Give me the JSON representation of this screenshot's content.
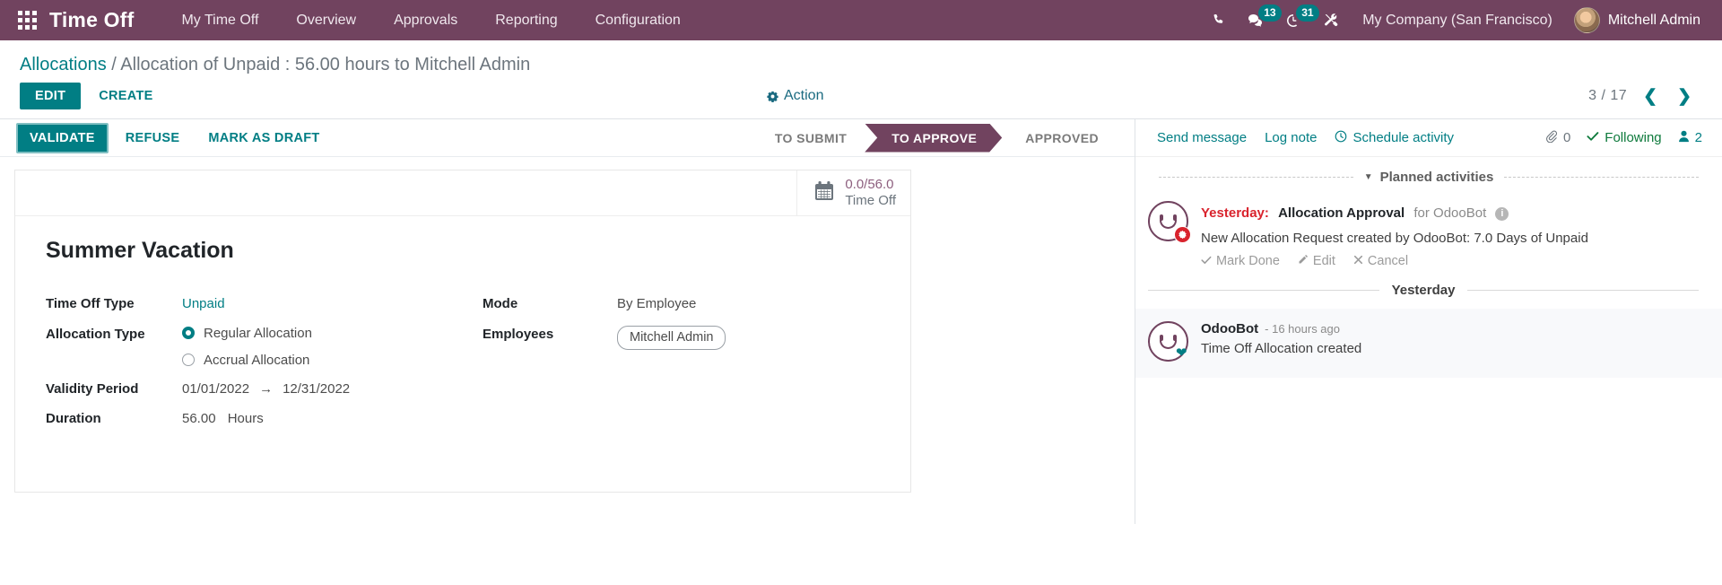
{
  "navbar": {
    "apps_icon": "apps-grid-icon",
    "brand": "Time Off",
    "menu": [
      {
        "label": "My Time Off"
      },
      {
        "label": "Overview"
      },
      {
        "label": "Approvals"
      },
      {
        "label": "Reporting"
      },
      {
        "label": "Configuration"
      }
    ],
    "icons": [
      {
        "name": "phone-icon",
        "badge": ""
      },
      {
        "name": "messages-icon",
        "badge": "13"
      },
      {
        "name": "activity-clock-icon",
        "badge": "31"
      },
      {
        "name": "tools-icon",
        "badge": ""
      }
    ],
    "company": "My Company (San Francisco)",
    "user": "Mitchell Admin",
    "bg_color": "#71435f",
    "badge_color": "#017e84"
  },
  "breadcrumb": {
    "root": "Allocations",
    "separator": "/",
    "current": "Allocation of Unpaid : 56.00 hours to Mitchell Admin"
  },
  "control_panel": {
    "edit_label": "EDIT",
    "create_label": "CREATE",
    "action_label": "Action",
    "action_icon": "gear-icon",
    "pager": {
      "count": "3 / 17",
      "prev_icon": "chevron-left-icon",
      "next_icon": "chevron-right-icon"
    }
  },
  "statusbar": {
    "buttons": [
      {
        "label": "VALIDATE",
        "primary": true
      },
      {
        "label": "REFUSE",
        "primary": false
      },
      {
        "label": "MARK AS DRAFT",
        "primary": false
      }
    ],
    "stages": [
      {
        "label": "TO SUBMIT",
        "active": false
      },
      {
        "label": "TO APPROVE",
        "active": true
      },
      {
        "label": "APPROVED",
        "active": false
      }
    ],
    "active_color": "#71435f"
  },
  "sheet": {
    "stat_button": {
      "icon": "calendar-icon",
      "value": "0.0/56.0",
      "label": "Time Off"
    },
    "title": "Summer Vacation",
    "fields": {
      "time_off_type_label": "Time Off Type",
      "time_off_type_value": "Unpaid",
      "allocation_type_label": "Allocation Type",
      "allocation_options": [
        {
          "label": "Regular Allocation",
          "selected": true
        },
        {
          "label": "Accrual Allocation",
          "selected": false
        }
      ],
      "validity_period_label": "Validity Period",
      "validity_from": "01/01/2022",
      "validity_arrow": "→",
      "validity_to": "12/31/2022",
      "duration_label": "Duration",
      "duration_value": "56.00",
      "duration_unit": "Hours",
      "mode_label": "Mode",
      "mode_value": "By Employee",
      "employees_label": "Employees",
      "employees_tag": "Mitchell Admin"
    }
  },
  "chatter": {
    "actions": [
      {
        "label": "Send message",
        "icon": ""
      },
      {
        "label": "Log note",
        "icon": ""
      },
      {
        "label": "Schedule activity",
        "icon": "clock-icon"
      }
    ],
    "attachments_count": "0",
    "attachments_icon": "paperclip-icon",
    "following_label": "Following",
    "following_icon": "check-icon",
    "followers_count": "2",
    "followers_icon": "user-icon",
    "planned_activities_title": "Planned activities",
    "planned_caret": "caret-down-icon",
    "activity": {
      "avatar": "odoobot-avatar",
      "marker_icon": "activity-alert-icon",
      "when": "Yesterday:",
      "name": "Allocation Approval",
      "assignee": "for OdooBot",
      "info_icon": "info-icon",
      "description": "New Allocation Request created by OdooBot: 7.0 Days of Unpaid",
      "links": [
        {
          "label": "Mark Done",
          "icon": "check-icon"
        },
        {
          "label": "Edit",
          "icon": "pencil-icon"
        },
        {
          "label": "Cancel",
          "icon": "close-icon"
        }
      ]
    },
    "day_separator": "Yesterday",
    "message": {
      "avatar": "odoobot-avatar",
      "heart_icon": "heart-icon",
      "author": "OdooBot",
      "time": "- 16 hours ago",
      "body": "Time Off Allocation created"
    }
  }
}
